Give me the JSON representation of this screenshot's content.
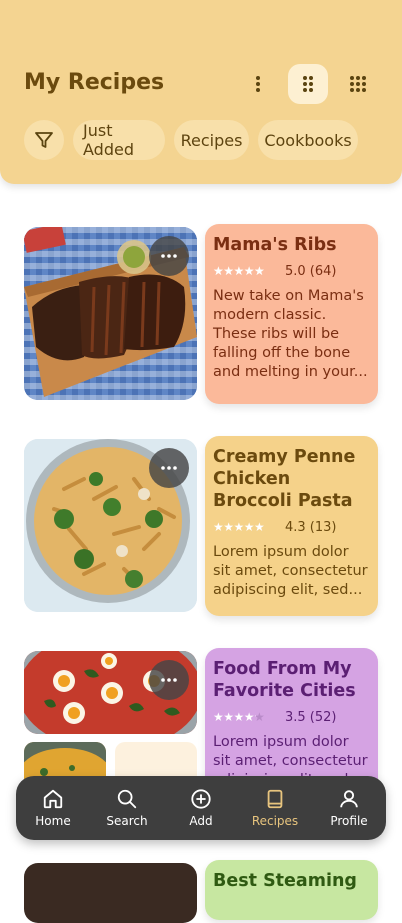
{
  "header": {
    "title": "My Recipes",
    "chips": [
      "Just Added",
      "Recipes",
      "Cookbooks"
    ]
  },
  "recipes": [
    {
      "title": "Mama's Ribs",
      "rating": "5.0 (64)",
      "stars": 5.0,
      "description": "New take on Mama's modern classic. These ribs will be falling off the bone and melting in your...",
      "color": "#fbb99a"
    },
    {
      "title": "Creamy Penne Chicken Broccoli Pasta",
      "rating": "4.3 (13)",
      "stars": 4.3,
      "description": "Lorem ipsum dolor sit amet, consectetur adipiscing elit, sed...",
      "color": "#f5d28a"
    },
    {
      "title": "Food From My Favorite Cities",
      "rating": "3.5 (52)",
      "stars": 3.5,
      "description": "Lorem ipsum dolor sit amet, consectetur adipiscing elit, sed...",
      "color": "#d5a3e3"
    },
    {
      "title": "Best Steaming",
      "color": "#c7e7a1"
    }
  ],
  "nav": [
    {
      "label": "Home",
      "icon": "home-icon"
    },
    {
      "label": "Search",
      "icon": "search-icon"
    },
    {
      "label": "Add",
      "icon": "add-icon"
    },
    {
      "label": "Recipes",
      "icon": "book-icon",
      "active": true
    },
    {
      "label": "Profile",
      "icon": "profile-icon"
    }
  ],
  "colors": {
    "header": "#f4d491",
    "accent": "#e7c47e",
    "nav": "#3e3e3e"
  }
}
